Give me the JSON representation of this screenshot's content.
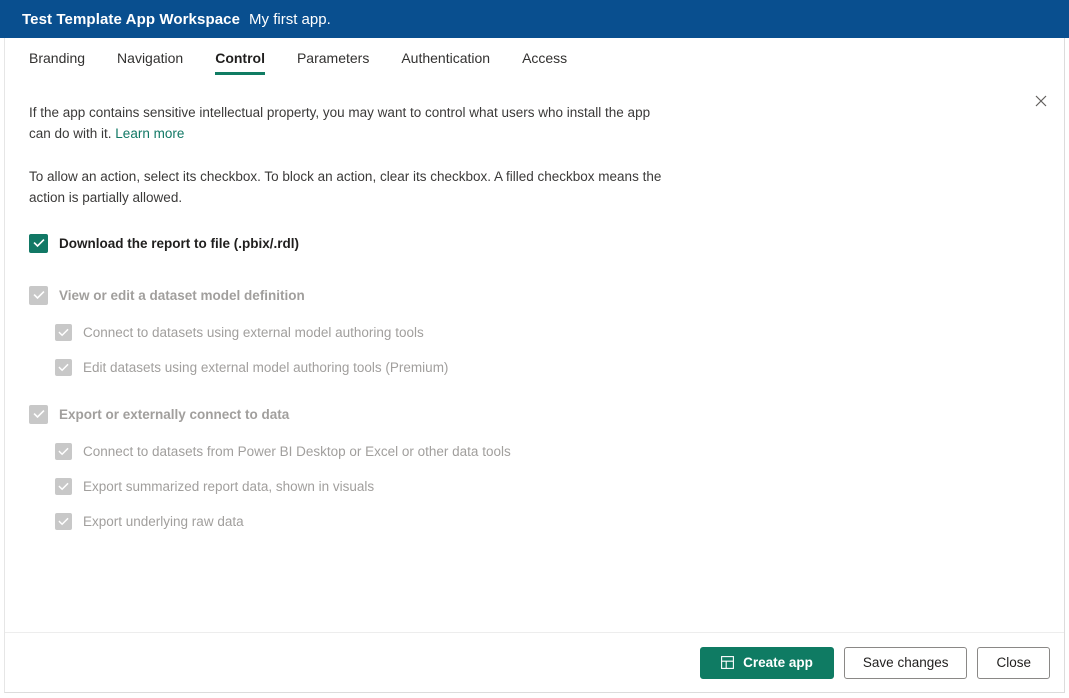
{
  "header": {
    "workspace_title": "Test Template App Workspace",
    "app_subtitle": "My first app.",
    "background_color": "#094f8f"
  },
  "tabs": [
    {
      "label": "Branding",
      "active": false
    },
    {
      "label": "Navigation",
      "active": false
    },
    {
      "label": "Control",
      "active": true
    },
    {
      "label": "Parameters",
      "active": false
    },
    {
      "label": "Authentication",
      "active": false
    },
    {
      "label": "Access",
      "active": false
    }
  ],
  "close_button": {
    "icon": "close-icon",
    "label": "Close panel"
  },
  "content": {
    "paragraph_1_prefix": "If the app contains sensitive intellectual property, you may want to control what users who install the app can do with it. ",
    "learn_more_link": "Learn more",
    "paragraph_2": "To allow an action, select its checkbox. To block an action, clear its checkbox. A filled checkbox means the action is partially allowed.",
    "checkboxes": [
      {
        "label": "Download the report to file (.pbix/.rdl)",
        "checked": true,
        "disabled": false,
        "bold": true,
        "level": 0
      },
      {
        "label": "View or edit a dataset model definition",
        "checked": true,
        "disabled": true,
        "bold": true,
        "level": 0
      },
      {
        "label": "Connect to datasets using external model authoring tools",
        "checked": true,
        "disabled": true,
        "bold": false,
        "level": 1
      },
      {
        "label": "Edit datasets using external model authoring tools (Premium)",
        "checked": true,
        "disabled": true,
        "bold": false,
        "level": 1
      },
      {
        "label": "Export or externally connect to data",
        "checked": true,
        "disabled": true,
        "bold": true,
        "level": 0
      },
      {
        "label": "Connect to datasets from Power BI Desktop or Excel or other data tools",
        "checked": true,
        "disabled": true,
        "bold": false,
        "level": 1
      },
      {
        "label": "Export summarized report data, shown in visuals",
        "checked": true,
        "disabled": true,
        "bold": false,
        "level": 1
      },
      {
        "label": "Export underlying raw data",
        "checked": true,
        "disabled": true,
        "bold": false,
        "level": 1
      }
    ]
  },
  "footer": {
    "create_app_label": "Create app",
    "create_app_icon": "app-grid-icon",
    "save_changes_label": "Save changes",
    "close_label": "Close"
  },
  "colors": {
    "header_blue": "#094f8f",
    "accent_teal": "#107c63",
    "primary_button": "#0f7b63",
    "disabled_gray": "#c8c8c8",
    "muted_text": "#a19f9d"
  }
}
